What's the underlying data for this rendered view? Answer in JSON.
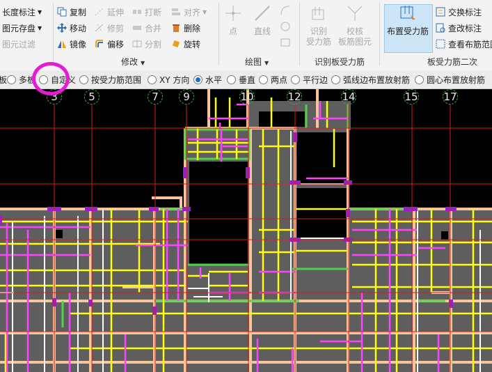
{
  "ribbon": {
    "left": {
      "length_label": "长度标注",
      "save_element": "图元存盘",
      "filter_element": "图元过滤"
    },
    "modify": {
      "group_label": "修改",
      "copy": "复制",
      "move": "移动",
      "mirror": "镜像",
      "extend": "延伸",
      "trim": "修剪",
      "offset": "偏移",
      "break": "打断",
      "merge": "合并",
      "split": "分割",
      "align": "对齐",
      "delete": "删除",
      "rotate": "旋转"
    },
    "draw": {
      "group_label": "绘图",
      "point": "点",
      "line": "直线"
    },
    "identify": {
      "group_label": "识别板受力筋",
      "identify_rebar": [
        "识别",
        "受力筋"
      ],
      "check_rebar": [
        "校核",
        "板筋图元"
      ]
    },
    "layout": {
      "group_label": "板受力筋二次",
      "place_rebar": "布置受力筋",
      "swap_annot": "交换标注",
      "check_annot": "查改标注",
      "view_range": "查看布筋范围"
    }
  },
  "options": [
    {
      "label": "板",
      "selected": false
    },
    {
      "label": "多板",
      "selected": false
    },
    {
      "label": "自定义",
      "selected": false
    },
    {
      "label": "按受力筋范围",
      "selected": false
    },
    {
      "label": "XY 方向",
      "selected": true
    },
    {
      "label": "水平",
      "selected": false
    },
    {
      "label": "垂直",
      "selected": false
    },
    {
      "label": "两点",
      "selected": false
    },
    {
      "label": "平行边",
      "selected": false
    },
    {
      "label": "弧线边布置放射筋",
      "selected": false
    },
    {
      "label": "圆心布置放射筋",
      "selected": false
    }
  ],
  "axes": [
    "3",
    "5",
    "7",
    "9",
    "10",
    "12",
    "14",
    "15",
    "17"
  ],
  "colors": {
    "accent": "#1d6fc4",
    "highlight_circle": "#e51bd5",
    "canvas_bg": "#000000",
    "slab": "#5e5e5e",
    "rebar_yellow": "#ffff00",
    "rebar_magenta": "#ff44ff",
    "beam_peach": "#f6c59a",
    "wall_green": "#55d04a",
    "axis_red": "#d51d1d"
  }
}
